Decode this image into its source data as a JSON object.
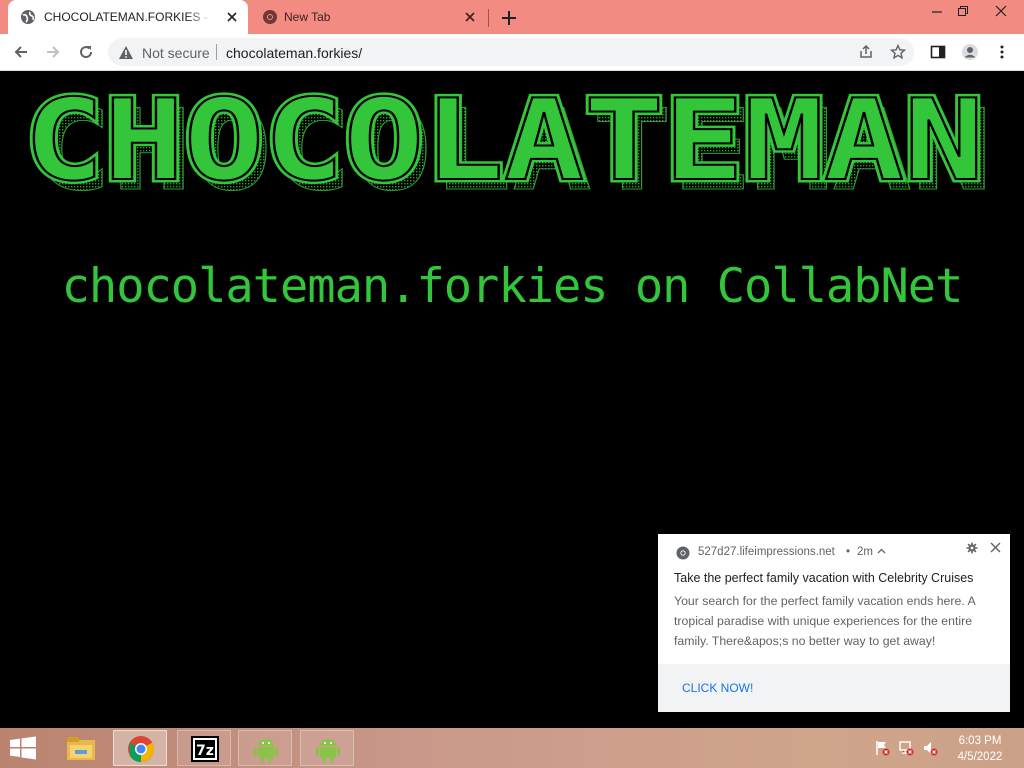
{
  "browser": {
    "tabs": [
      {
        "title": "CHOCOLATEMAN.FORKIES - WEB",
        "active": true
      },
      {
        "title": "New Tab",
        "active": false
      }
    ],
    "security_label": "Not secure",
    "url": "chocolateman.forkies/"
  },
  "page": {
    "logo_text": "CHOCOLATEMAN",
    "subtitle": "chocolateman.forkies on CollabNet",
    "accent_color": "#33c63a",
    "background_color": "#000000"
  },
  "notification": {
    "origin": "527d27.lifeimpressions.net",
    "separator": "•",
    "age": "2m",
    "title": "Take the perfect family vacation with Celebrity Cruises",
    "body": "Your search for the perfect family vacation ends here. A tropical paradise with unique experiences for the entire family. There&apos;s no better way to get away!",
    "action_label": "CLICK NOW!"
  },
  "taskbar": {
    "apps": [
      {
        "name": "file-explorer-icon",
        "state": "pinned"
      },
      {
        "name": "chrome-icon",
        "state": "active"
      },
      {
        "name": "7zip-icon",
        "state": "running"
      },
      {
        "name": "android-icon",
        "state": "running"
      },
      {
        "name": "android-icon",
        "state": "running"
      }
    ],
    "time": "6:03 PM",
    "date": "4/5/2022"
  }
}
